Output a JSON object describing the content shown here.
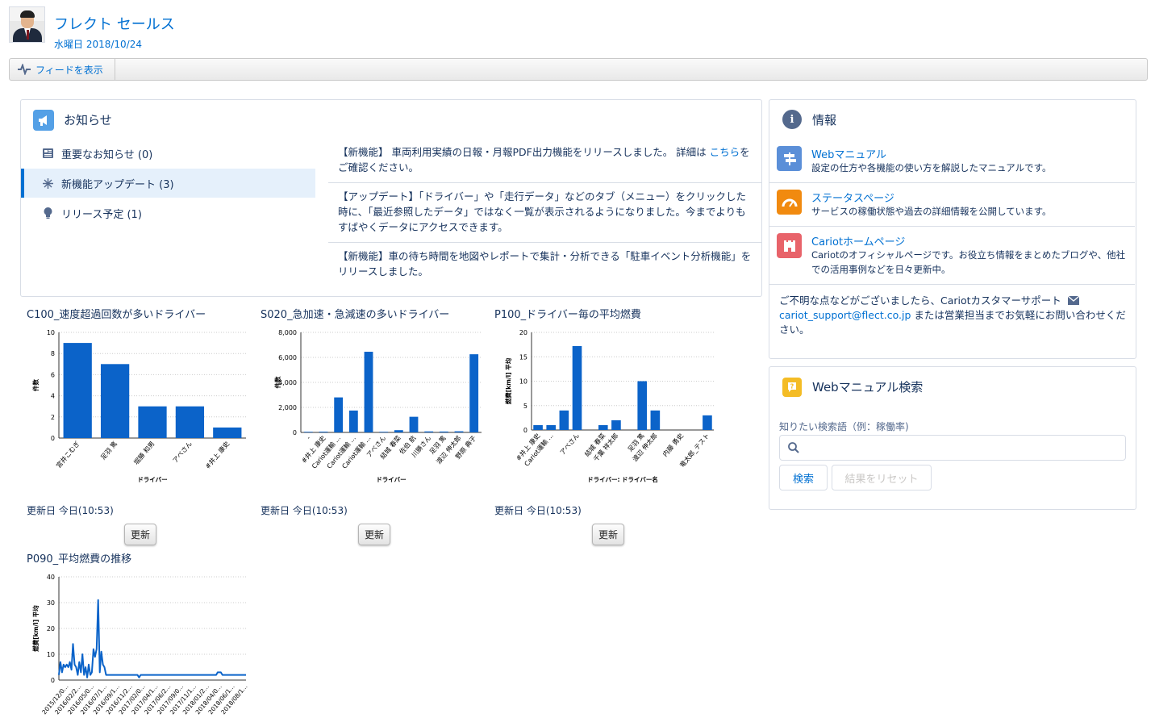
{
  "header": {
    "user_name": "フレクト セールス",
    "date": "水曜日 2018/10/24",
    "feed_button": "フィードを表示"
  },
  "news": {
    "title": "お知らせ",
    "categories": [
      {
        "label": "重要なお知らせ (0)",
        "icon": "news-icon"
      },
      {
        "label": "新機能アップデート (3)",
        "icon": "sparkle-icon",
        "active": true
      },
      {
        "label": "リリース予定 (1)",
        "icon": "lightbulb-icon"
      }
    ],
    "entries": [
      {
        "text": "【新機能】 車両利用実績の日報・月報PDF出力機能をリリースしました。 詳細は ",
        "link": "こちら",
        "text_after": "をご確認ください。"
      },
      {
        "text": "【アップデート】「ドライバー」や「走行データ」などのタブ（メニュー）をクリックした時に、「最近参照したデータ」ではなく一覧が表示されるようになりました。今までよりもすばやくデータにアクセスできます。"
      },
      {
        "text": "【新機能】車の待ち時間を地図やレポートで集計・分析できる「駐車イベント分析機能」をリリースしました。"
      }
    ]
  },
  "info": {
    "title": "情報",
    "items": [
      {
        "link": "Webマニュアル",
        "desc": "設定の仕方や各機能の使い方を解説したマニュアルです。",
        "icon": "signpost-icon",
        "color": "#5b8fd8"
      },
      {
        "link": "ステータスページ",
        "desc": "サービスの稼働状態や過去の詳細情報を公開しています。",
        "icon": "gauge-icon",
        "color": "#f18a0f"
      },
      {
        "link": "Cariotホームページ",
        "desc": "Cariotのオフィシャルページです。お役立ち情報をまとめたブログや、他社での活用事例などを日々更新中。",
        "icon": "castle-icon",
        "color": "#e8636a"
      }
    ],
    "contact_before": "ご不明な点などがございましたら、Cariotカスタマーサポート",
    "contact_email": "cariot_support@flect.co.jp",
    "contact_after": " または営業担当までお気軽にお問い合わせください。"
  },
  "search": {
    "title": "Webマニュアル検索",
    "label": "知りたい検索語（例：稼働率)",
    "search_button": "検索",
    "reset_button": "結果をリセット"
  },
  "update": {
    "label": "更新日 今日(10:53)",
    "button": "更新"
  },
  "colors": {
    "bar": "#0b63c9",
    "link": "#0070d2"
  },
  "chart_data": [
    {
      "id": "c100",
      "type": "bar",
      "title": "C100_速度超過回数が多いドライバー",
      "xlabel": "ドライバー",
      "ylabel": "件数",
      "ylim": [
        0,
        10
      ],
      "yticks": [
        0,
        2,
        4,
        6,
        8,
        10
      ],
      "categories": [
        "宮井こむぎ",
        "足羽 篤",
        "堀勝 和男",
        "アベさん",
        "#井上 康史"
      ],
      "values": [
        9,
        7,
        3,
        3,
        1
      ]
    },
    {
      "id": "s020",
      "type": "bar",
      "title": "S020_急加速・急減速の多いドライバー",
      "xlabel": "ドライバー",
      "ylabel": "件数",
      "ylim": [
        0,
        8000
      ],
      "yticks": [
        0,
        2000,
        4000,
        6000,
        8000
      ],
      "ytick_labels": [
        "0",
        "2,000",
        "4,000",
        "6,000",
        "8,000"
      ],
      "categories": [
        "-",
        "#井上 康史",
        "Cariot運輸 ...",
        "Cariot運輸 ...",
        "Cariot運輸 ...",
        "アベさん",
        "結城 春菜",
        "佐伯 航",
        "川勝さん",
        "足羽 篤",
        "渡辺 伸太郎",
        "野原 典子"
      ],
      "values": [
        50,
        60,
        2800,
        1750,
        6450,
        50,
        180,
        1250,
        80,
        70,
        90,
        6250
      ]
    },
    {
      "id": "p100",
      "type": "bar",
      "title": "P100_ドライバー毎の平均燃費",
      "xlabel": "ドライバー: ドライバー名",
      "ylabel": "燃費[km/l] 平均",
      "ylim": [
        0,
        20
      ],
      "yticks": [
        0,
        5,
        10,
        15,
        20
      ],
      "categories": [
        "#井上 康史",
        "Cariot運輸 ...",
        "",
        "アベさん",
        "",
        "結城 春菜",
        "千葉 祥太郎",
        "",
        "足羽 篤",
        "渡辺 伸太郎",
        "",
        "内藤 勇史",
        "",
        "竜太郎_テスト"
      ],
      "values": [
        1,
        1,
        4,
        17.2,
        0,
        1,
        2,
        0,
        10,
        4,
        0,
        0,
        0,
        3
      ]
    },
    {
      "id": "p090",
      "type": "line",
      "title": "P090_平均燃費の推移",
      "ylabel": "燃費[km/l] 平均",
      "ylim": [
        0,
        40
      ],
      "yticks": [
        0,
        10,
        20,
        30,
        40
      ],
      "xtick_labels": [
        "2015/12/0...",
        "2016/02/2...",
        "2016/05/0...",
        "2016/07/1...",
        "2016/09/1...",
        "2016/11/2...",
        "2017/02/0...",
        "2017/04/1...",
        "2017/06/2...",
        "2017/09/0...",
        "2017/11/1...",
        "2018/01/2...",
        "2018/04/0...",
        "2018/06/1...",
        "2018/08/1..."
      ],
      "values": [
        2,
        7,
        3,
        6,
        5,
        6,
        5,
        7,
        4,
        14,
        6,
        5,
        2,
        7,
        3,
        10,
        2,
        5,
        1,
        6,
        2,
        3,
        12,
        9,
        12,
        31,
        3,
        11,
        6,
        5,
        2,
        2,
        2,
        2,
        2,
        2,
        2,
        2,
        2,
        2,
        2,
        2,
        2,
        2,
        2,
        2,
        2,
        2,
        2,
        2,
        2,
        1,
        2,
        2,
        2,
        2,
        2,
        2,
        2,
        2,
        2,
        2,
        2,
        2,
        2,
        2,
        2,
        2,
        2,
        2,
        2,
        2,
        2,
        2,
        2,
        2,
        2,
        2,
        2,
        2,
        2,
        2,
        2,
        2,
        2,
        2,
        2,
        2,
        2,
        2,
        2,
        2,
        2,
        2,
        2,
        2,
        2,
        2,
        2,
        2,
        2,
        3,
        3,
        3,
        2,
        2,
        2,
        2,
        2,
        2,
        2,
        2,
        2,
        2,
        2,
        2,
        2,
        2,
        2,
        2
      ]
    }
  ]
}
